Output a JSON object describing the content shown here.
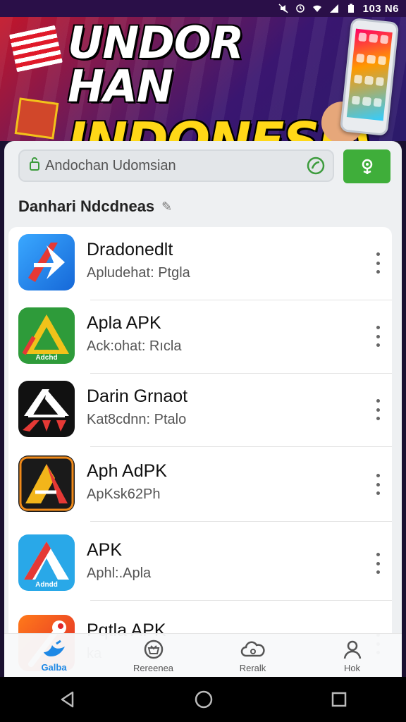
{
  "status_bar": {
    "time": "103 N6",
    "icons": [
      "mute-icon",
      "alarm-icon",
      "wifi-icon",
      "signal-icon",
      "battery-icon"
    ]
  },
  "banner": {
    "line1": "UNDOR HAN",
    "line2": "INDONESIA"
  },
  "search": {
    "value": "Andochan Udomsian",
    "placeholder": ""
  },
  "section": {
    "title": "Danhari Ndcdneas"
  },
  "apps": [
    {
      "name": "Dradonedlt",
      "subtitle": "Apludehat: Ptgla",
      "icon": "blue-arrow-app-icon"
    },
    {
      "name": "Apla APK",
      "subtitle": "Ack:ohat: Rıcla",
      "icon": "green-triangle-app-icon",
      "icon_text": "Adchd"
    },
    {
      "name": "Darin Grnaot",
      "subtitle": "Kat8cdnn: Ptalo",
      "icon": "black-red-app-icon"
    },
    {
      "name": "Aph AdPK",
      "subtitle": "ApKsk62Ph",
      "icon": "orange-a-app-icon"
    },
    {
      "name": "APK",
      "subtitle": "Aphl:.Apla",
      "icon": "sky-a-app-icon",
      "icon_text": "Adndd"
    },
    {
      "name": "Pqtla APK",
      "subtitle": "ka",
      "icon": "red-wrench-app-icon"
    }
  ],
  "tabs": [
    {
      "label": "Galba",
      "icon": "bird-icon",
      "active": true
    },
    {
      "label": "Rereenea",
      "icon": "basket-icon",
      "active": false
    },
    {
      "label": "Reralk",
      "icon": "cloud-icon",
      "active": false
    },
    {
      "label": "Hok",
      "icon": "person-icon",
      "active": false
    }
  ],
  "colors": {
    "accent": "#3fae3a",
    "tab_active": "#1e88e5",
    "banner_yellow": "#ffd817"
  }
}
